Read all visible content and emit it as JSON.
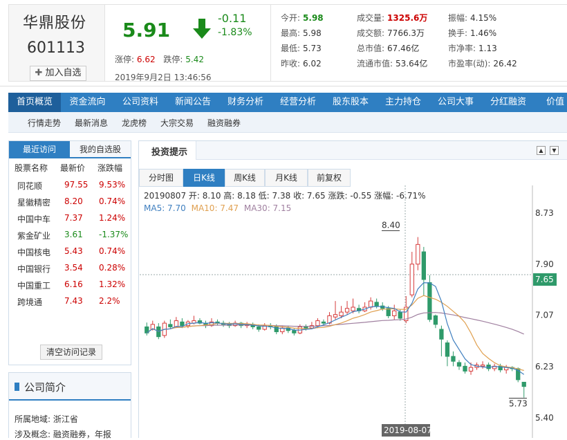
{
  "stock": {
    "name": "华鼎股份",
    "code": "601113",
    "add_label": "加入自选"
  },
  "quote": {
    "price": "5.91",
    "change": "-0.11",
    "change_pct": "-1.83%",
    "limit_up_label": "涨停:",
    "limit_up": "6.62",
    "limit_down_label": "跌停:",
    "limit_down": "5.42",
    "timestamp": "2019年9月2日 13:46:56"
  },
  "stats": [
    {
      "label": "今开:",
      "value": "5.98",
      "style": "grn"
    },
    {
      "label": "成交量:",
      "value": "1325.6万",
      "style": "red"
    },
    {
      "label": "振幅:",
      "value": "4.15%",
      "style": ""
    },
    {
      "label": "最高:",
      "value": "5.98",
      "style": ""
    },
    {
      "label": "成交额:",
      "value": "7766.3万",
      "style": ""
    },
    {
      "label": "换手:",
      "value": "1.46%",
      "style": ""
    },
    {
      "label": "最低:",
      "value": "5.73",
      "style": ""
    },
    {
      "label": "总市值:",
      "value": "67.46亿",
      "style": ""
    },
    {
      "label": "市净率:",
      "value": "1.13",
      "style": ""
    },
    {
      "label": "昨收:",
      "value": "6.02",
      "style": ""
    },
    {
      "label": "流通市值:",
      "value": "53.64亿",
      "style": ""
    },
    {
      "label": "市盈率(动):",
      "value": "26.42",
      "style": ""
    }
  ],
  "nav": [
    "首页概览",
    "资金流向",
    "公司资料",
    "新闻公告",
    "财务分析",
    "经营分析",
    "股东股本",
    "主力持仓",
    "公司大事",
    "分红融资",
    "价值"
  ],
  "subnav": [
    "行情走势",
    "最新消息",
    "龙虎榜",
    "大宗交易",
    "融资融券"
  ],
  "left": {
    "tabs": [
      "最近访问",
      "我的自选股"
    ],
    "headers": [
      "股票名称",
      "最新价",
      "涨跌幅"
    ],
    "rows": [
      {
        "name": "同花顺",
        "price": "97.55",
        "pct": "9.53%",
        "up": true
      },
      {
        "name": "星徽精密",
        "price": "8.20",
        "pct": "0.74%",
        "up": true
      },
      {
        "name": "中国中车",
        "price": "7.37",
        "pct": "1.24%",
        "up": true
      },
      {
        "name": "紫金矿业",
        "price": "3.61",
        "pct": "-1.37%",
        "up": false
      },
      {
        "name": "中国核电",
        "price": "5.43",
        "pct": "0.74%",
        "up": true
      },
      {
        "name": "中国银行",
        "price": "3.54",
        "pct": "0.28%",
        "up": true
      },
      {
        "name": "中国重工",
        "price": "6.16",
        "pct": "1.32%",
        "up": true
      },
      {
        "name": "跨境通",
        "price": "7.43",
        "pct": "2.2%",
        "up": true
      }
    ],
    "clear_label": "清空访问记录"
  },
  "intro": {
    "title": "公司简介",
    "lines": [
      "所属地域:  浙江省",
      "涉及概念:  融资融券，年报"
    ]
  },
  "main": {
    "title": "投资提示",
    "ktabs": [
      "分时图",
      "日K线",
      "周K线",
      "月K线",
      "前复权"
    ],
    "info_line": "20190807 开: 8.10 高: 8.18 低: 7.38 收: 7.65 涨跌: -0.55 涨幅: -6.71%",
    "ma_line": {
      "ma5": "MA5: 7.70",
      "ma10": "MA10: 7.47",
      "ma30": "MA30: 7.15"
    },
    "axis_labels": [
      "8.73",
      "7.90",
      "7.07",
      "6.23",
      "5.40"
    ],
    "current_marker": "7.65",
    "high_label": "8.40",
    "low_label": "5.73",
    "date_label": "2019-08-07",
    "colors": {
      "up": "#d63b3b",
      "down": "#2f9a6a",
      "ma5": "#3f7fbf",
      "ma10": "#e0a050",
      "ma30": "#a080a0"
    }
  }
}
